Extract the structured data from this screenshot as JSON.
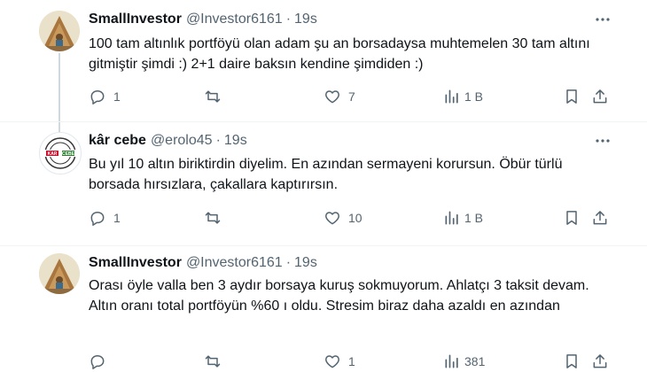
{
  "tweets": [
    {
      "name": "SmallInvestor",
      "handle": "@Investor6161",
      "dot": "·",
      "time": "19s",
      "text": "100 tam altınlık portföyü olan adam şu an borsadaysa muhtemelen 30 tam altını gitmiştir şimdi :) 2+1 daire baksın kendine şimdiden :)",
      "replies": "1",
      "retweets": "",
      "likes": "7",
      "views": "1 B"
    },
    {
      "name": "kâr cebe",
      "handle": "@erolo45",
      "dot": "·",
      "time": "19s",
      "text": "Bu yıl 10 altın biriktirdin diyelim. En azından sermayeni korursun. Öbür türlü borsada hırsızlara, çakallara kaptırırsın.",
      "replies": "1",
      "retweets": "",
      "likes": "10",
      "views": "1 B"
    },
    {
      "name": "SmallInvestor",
      "handle": "@Investor6161",
      "dot": "·",
      "time": "19s",
      "text": "Orası öyle valla ben 3 aydır borsaya kuruş sokmuyorum. Ahlatçı 3 taksit devam. Altın oranı total portföyün %60 ı oldu. Stresim biraz daha azaldı en azından",
      "replies": "",
      "retweets": "",
      "likes": "1",
      "views": "381"
    }
  ],
  "avatar_logo_text": "KAR CEBE",
  "colors": {
    "text": "#0f1419",
    "secondary": "#536471",
    "thread_line": "#cfd9de",
    "divider": "#eff3f4"
  },
  "icons": [
    "reply-icon",
    "retweet-icon",
    "like-icon",
    "views-icon",
    "bookmark-icon",
    "share-icon",
    "more-icon"
  ]
}
